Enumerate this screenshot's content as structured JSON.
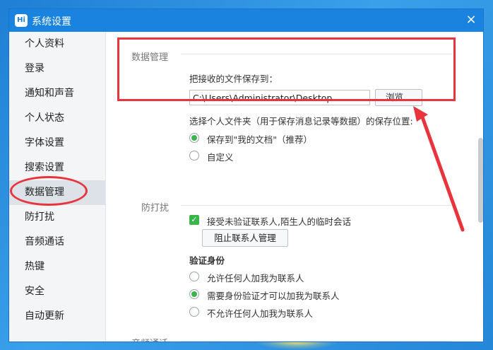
{
  "window": {
    "title": "系统设置",
    "app_icon": "Hi",
    "close_symbol": "×"
  },
  "sidebar": {
    "items": [
      {
        "label": "个人资料"
      },
      {
        "label": "登录"
      },
      {
        "label": "通知和声音"
      },
      {
        "label": "个人状态"
      },
      {
        "label": "字体设置"
      },
      {
        "label": "搜索设置"
      },
      {
        "label": "数据管理",
        "active": true
      },
      {
        "label": "防打扰"
      },
      {
        "label": "音频通话"
      },
      {
        "label": "热键"
      },
      {
        "label": "安全"
      },
      {
        "label": "自动更新"
      }
    ]
  },
  "data_management": {
    "title": "数据管理",
    "save_to_label": "把接收的文件保存到：",
    "path_value": "C:\\Users\\Administrator\\Desktop",
    "browse_button": "浏览...",
    "personal_folder_label": "选择个人文件夹（用于保存消息记录等数据）的保存位置:",
    "option_my_docs": "保存到\"我的文档\"（推荐）",
    "option_custom": "自定义"
  },
  "do_not_disturb": {
    "title": "防打扰",
    "accept_unverified": "接受未验证联系人,陌生人的临时会话",
    "block_button": "阻止联系人管理",
    "verify_title": "验证身份",
    "option_allow_all": "允许任何人加我为联系人",
    "option_need_verify": "需要身份验证才可以加我为联系人",
    "option_deny_all": "不允许任何人加我为联系人"
  },
  "audio_call": {
    "title": "音频通话"
  },
  "colors": {
    "titlebar": "#1a83e0",
    "annotation_red": "#e8343c",
    "check_green": "#3ab54a"
  }
}
